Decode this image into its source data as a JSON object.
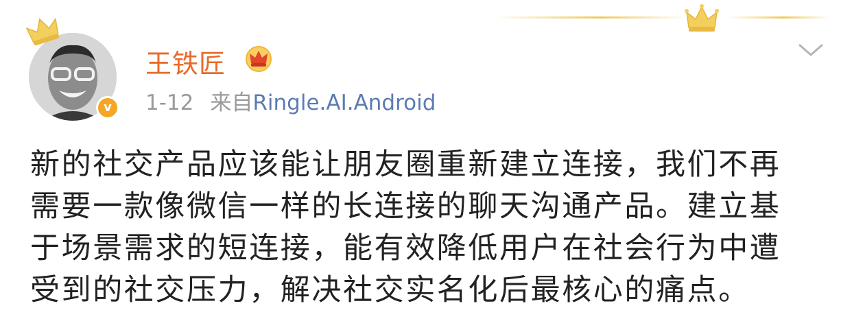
{
  "post": {
    "author": "王铁匠",
    "date": "1-12",
    "source_prefix": "来自",
    "source_link": "Ringle.AI.Android",
    "verified_mark": "v",
    "content_lines": [
      "新的社交产品应该能让朋友圈重新建立连接，我们不再",
      "需要一款像微信一样的长连接的聊天沟通产品。建立基",
      "于场景需求的短连接，能有效降低用户在社会行为中遭",
      "受到的社交压力，解决社交实名化后最核心的痛点。"
    ]
  },
  "icons": {
    "avatar_crown": "crown-icon",
    "header_crown": "crown-icon",
    "vip_badge": "vip-crown-badge-icon",
    "verified": "verified-badge-icon",
    "more": "chevron-down-icon"
  },
  "colors": {
    "author": "#e86a2a",
    "meta": "#9a9a9a",
    "link": "#5b7bb3",
    "badge": "#f5a623",
    "crown": "#f0c85a",
    "text": "#222222"
  }
}
